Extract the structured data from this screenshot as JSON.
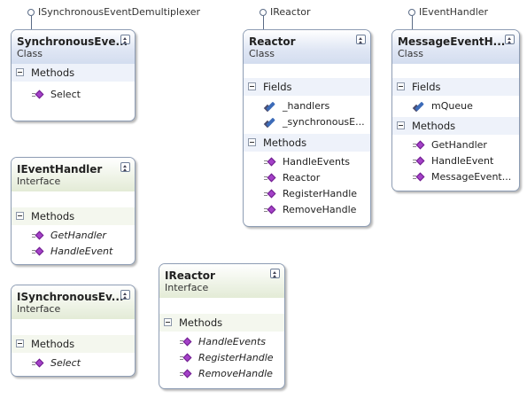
{
  "lollipops": [
    {
      "label": "ISynchronousEventDemultiplexer"
    },
    {
      "label": "IReactor"
    },
    {
      "label": "IEventHandler"
    }
  ],
  "shapes": [
    {
      "name": "SynchronousEve...",
      "kind": "Class",
      "sections": [
        {
          "title": "Methods",
          "items": [
            "Select"
          ]
        }
      ]
    },
    {
      "name": "Reactor",
      "kind": "Class",
      "sections": [
        {
          "title": "Fields",
          "items": [
            "_handlers",
            "_synchronousE..."
          ]
        },
        {
          "title": "Methods",
          "items": [
            "HandleEvents",
            "Reactor",
            "RegisterHandle",
            "RemoveHandle"
          ]
        }
      ]
    },
    {
      "name": "MessageEventH...",
      "kind": "Class",
      "sections": [
        {
          "title": "Fields",
          "items": [
            "mQueue"
          ]
        },
        {
          "title": "Methods",
          "items": [
            "GetHandler",
            "HandleEvent",
            "MessageEvent..."
          ]
        }
      ]
    },
    {
      "name": "IEventHandler",
      "kind": "Interface",
      "sections": [
        {
          "title": "Methods",
          "items": [
            "GetHandler",
            "HandleEvent"
          ]
        }
      ]
    },
    {
      "name": "IReactor",
      "kind": "Interface",
      "sections": [
        {
          "title": "Methods",
          "items": [
            "HandleEvents",
            "RegisterHandle",
            "RemoveHandle"
          ]
        }
      ]
    },
    {
      "name": "ISynchronousEv...",
      "kind": "Interface",
      "sections": [
        {
          "title": "Methods",
          "items": [
            "Select"
          ]
        }
      ]
    }
  ]
}
